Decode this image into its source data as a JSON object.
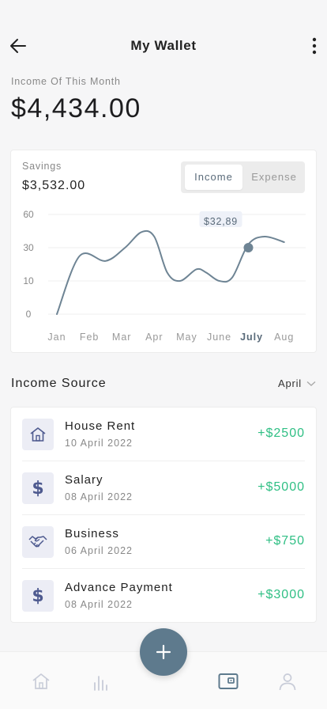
{
  "header": {
    "title": "My Wallet"
  },
  "summary": {
    "label": "Income Of This Month",
    "amount": "$4,434.00"
  },
  "savings_card": {
    "label": "Savings",
    "value": "$3,532.00",
    "toggle": {
      "income_label": "Income",
      "expense_label": "Expense",
      "selected": "Income"
    }
  },
  "chart_data": {
    "type": "line",
    "categories": [
      "Jan",
      "Feb",
      "Mar",
      "Apr",
      "May",
      "June",
      "July",
      "Aug"
    ],
    "x_start": "Jan",
    "x_end": "Aug",
    "yticks": [
      "60",
      "30",
      "10",
      "0"
    ],
    "ytick_values": [
      60,
      30,
      10,
      0
    ],
    "series": [
      {
        "values": [
          0,
          27,
          30,
          45,
          17,
          10,
          30,
          30
        ],
        "points": [
          [
            0,
            0
          ],
          [
            0.7,
            25
          ],
          [
            1.5,
            22
          ],
          [
            2.1,
            30
          ],
          [
            2.6,
            44
          ],
          [
            3.0,
            40
          ],
          [
            3.4,
            15
          ],
          [
            3.8,
            10
          ],
          [
            4.3,
            17
          ],
          [
            4.6,
            15
          ],
          [
            5.0,
            10
          ],
          [
            5.4,
            12
          ],
          [
            5.9,
            33
          ],
          [
            6.4,
            40
          ],
          [
            7.0,
            35
          ]
        ]
      }
    ],
    "highlight": {
      "category": "July",
      "value": 30,
      "x": 5.9,
      "label": "$32,89"
    },
    "grid": true,
    "colors": {
      "line": "#6e8494",
      "grid": "#efefef",
      "tooltip_bg": "#eef1f8"
    }
  },
  "income_source": {
    "title": "Income Source",
    "filter": "April",
    "items": [
      {
        "icon": "house-icon",
        "title": "House Rent",
        "date": "10 April 2022",
        "amount": "+$2500"
      },
      {
        "icon": "dollar-icon",
        "title": "Salary",
        "date": "08 April 2022",
        "amount": "+$5000"
      },
      {
        "icon": "handshake-icon",
        "title": "Business",
        "date": "06 April 2022",
        "amount": "+$750"
      },
      {
        "icon": "dollar-icon",
        "title": "Advance Payment",
        "date": "08 April 2022",
        "amount": "+$3000"
      }
    ],
    "dollar_symbol": "$"
  },
  "nav": {
    "items": [
      "home-icon",
      "stats-icon",
      "wallet-icon",
      "profile-icon"
    ],
    "active": "wallet-icon"
  },
  "colors": {
    "accent": "#5e7a8d",
    "positive": "#2fbf84",
    "icon_bg": "#ecedf5"
  }
}
